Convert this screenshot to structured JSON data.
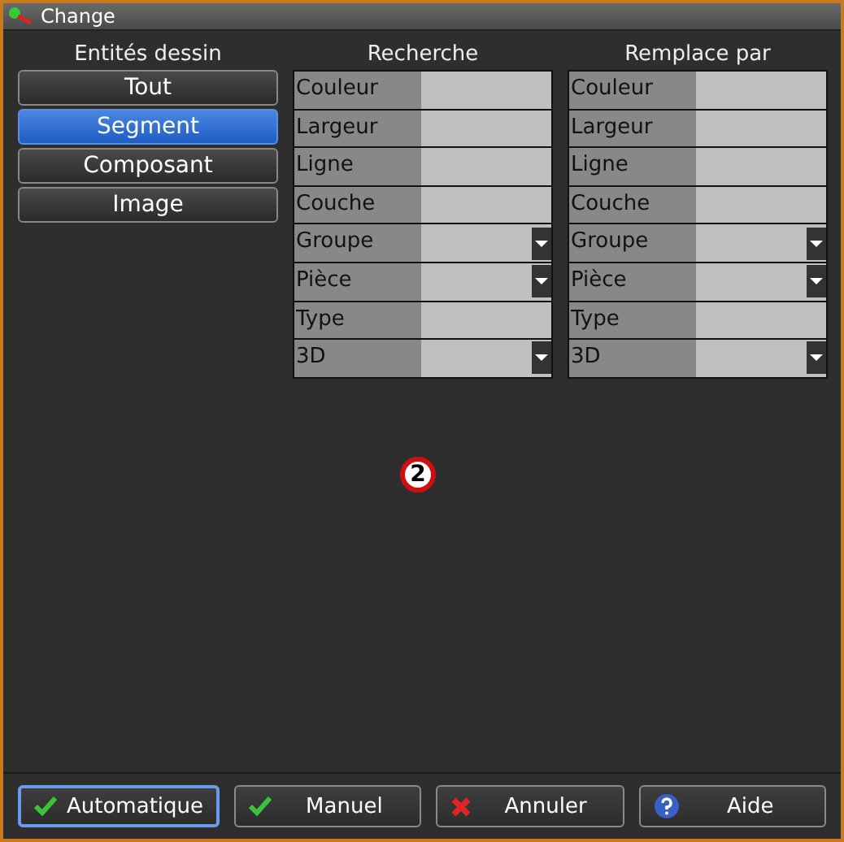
{
  "window": {
    "title": "Change"
  },
  "entities": {
    "heading": "Entités dessin",
    "items": [
      {
        "label": "Tout",
        "selected": false
      },
      {
        "label": "Segment",
        "selected": true
      },
      {
        "label": "Composant",
        "selected": false
      },
      {
        "label": "Image",
        "selected": false
      }
    ]
  },
  "search": {
    "heading": "Recherche",
    "fields": [
      {
        "label": "Couleur",
        "kind": "text"
      },
      {
        "label": "Largeur",
        "kind": "text"
      },
      {
        "label": "Ligne",
        "kind": "text"
      },
      {
        "label": "Couche",
        "kind": "text"
      },
      {
        "label": "Groupe",
        "kind": "dropdown"
      },
      {
        "label": "Pièce",
        "kind": "dropdown"
      },
      {
        "label": "Type",
        "kind": "text"
      },
      {
        "label": "3D",
        "kind": "dropdown"
      }
    ]
  },
  "replace": {
    "heading": "Remplace par",
    "fields": [
      {
        "label": "Couleur",
        "kind": "text"
      },
      {
        "label": "Largeur",
        "kind": "text"
      },
      {
        "label": "Ligne",
        "kind": "text"
      },
      {
        "label": "Couche",
        "kind": "text"
      },
      {
        "label": "Groupe",
        "kind": "dropdown"
      },
      {
        "label": "Pièce",
        "kind": "dropdown"
      },
      {
        "label": "Type",
        "kind": "text"
      },
      {
        "label": "3D",
        "kind": "dropdown"
      }
    ]
  },
  "marker": "2",
  "buttons": [
    {
      "label": "Automatique",
      "kind": "confirm",
      "focused": true
    },
    {
      "label": "Manuel",
      "kind": "confirm",
      "focused": false
    },
    {
      "label": "Annuler",
      "kind": "cancel",
      "focused": false
    },
    {
      "label": "Aide",
      "kind": "help",
      "focused": false
    }
  ]
}
